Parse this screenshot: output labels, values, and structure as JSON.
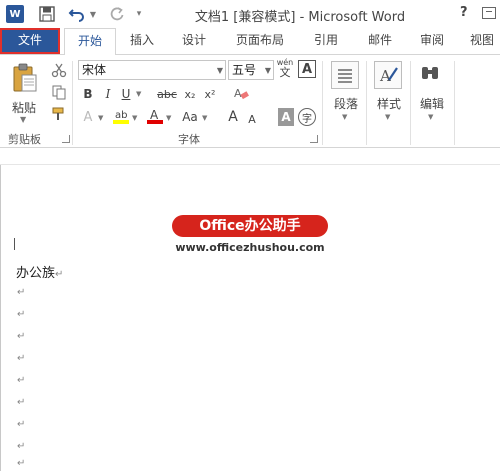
{
  "window": {
    "title": "文档1 [兼容模式] - Microsoft Word",
    "logo_text": "W",
    "help": "?"
  },
  "tabs": {
    "file": "文件",
    "home": "开始",
    "insert": "插入",
    "design": "设计",
    "layout": "页面布局",
    "references": "引用",
    "mailings": "邮件",
    "review": "审阅",
    "view": "视图"
  },
  "ribbon": {
    "clipboard": {
      "paste_label": "粘贴",
      "group_label": "剪贴板"
    },
    "font": {
      "font_name": "宋体",
      "font_size": "五号",
      "group_label": "字体",
      "bold": "B",
      "italic": "I",
      "underline": "U",
      "strikethrough": "abc",
      "subscript": "x₂",
      "superscript": "x²",
      "grow": "A",
      "shrink": "A",
      "change_case": "Aa",
      "char_shading": "A",
      "phonetic": "wén",
      "enclose": "字"
    },
    "paragraph": {
      "label": "段落"
    },
    "styles": {
      "label": "样式"
    },
    "editing": {
      "label": "编辑"
    }
  },
  "document": {
    "watermark_title": "Office办公助手",
    "watermark_url": "www.officezhushou.com",
    "first_line": "办公族",
    "para_mark": "↵"
  },
  "colors": {
    "accent": "#2b579a",
    "file_tab_border": "#e0302b",
    "watermark_bg": "#d6241c",
    "highlight_yellow": "#ffff00",
    "font_color_red": "#e00000"
  }
}
